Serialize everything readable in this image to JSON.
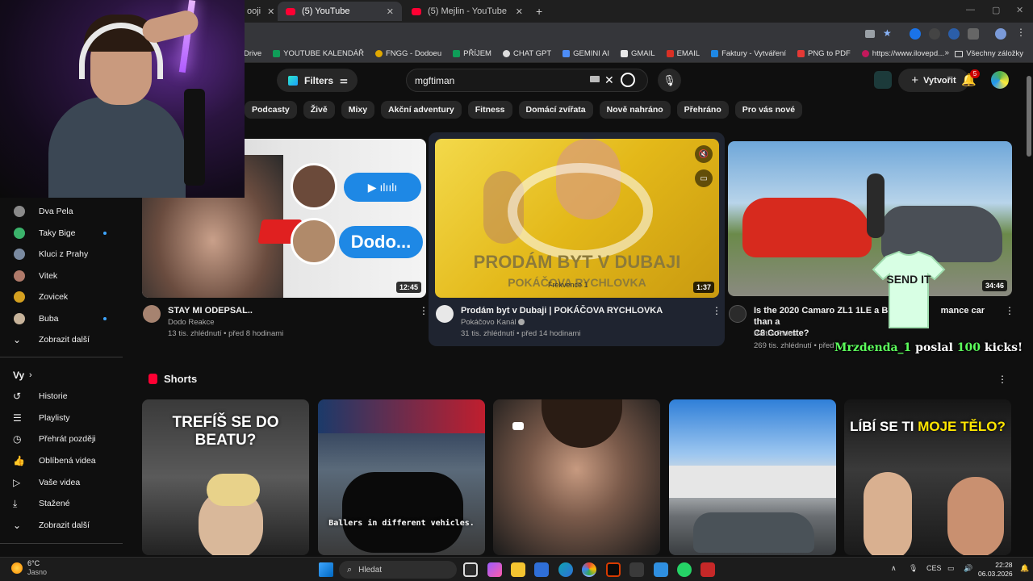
{
  "browser": {
    "tabs": [
      {
        "label": "ooji",
        "active": false
      },
      {
        "label": "(5) YouTube",
        "active": true
      },
      {
        "label": "(5) Mejlin - YouTube",
        "active": false
      }
    ],
    "bookmarks": [
      "Drive",
      "YOUTUBE KALENDÁŘ",
      "FNGG - Dodoeu",
      "PŘÍJEM",
      "CHAT GPT",
      "GEMINI AI",
      "GMAIL",
      "EMAIL",
      "Faktury - Vytváření",
      "PNG to PDF",
      "https://www.ilovepd..."
    ],
    "all_bookmarks": "Všechny záložky"
  },
  "header": {
    "filters_label": "Filters",
    "search_value": "mgftiman",
    "create_label": "Vytvořit",
    "notifications_count": "5"
  },
  "chips": [
    "Podcasty",
    "Živě",
    "Mixy",
    "Akční adventury",
    "Fitness",
    "Domácí zvířata",
    "Nově nahráno",
    "Přehráno",
    "Pro vás nové"
  ],
  "sidebar": {
    "subscriptions": [
      {
        "label": "Dva Pela",
        "color": "#8a8a8a",
        "dot": false
      },
      {
        "label": "Taky Bige",
        "color": "#3bb36b",
        "dot": true
      },
      {
        "label": "Kluci z Prahy",
        "color": "#7a8aa0",
        "dot": false
      },
      {
        "label": "Vitek",
        "color": "#b07a6a",
        "dot": false
      },
      {
        "label": "Zovicek",
        "color": "#d4a020",
        "dot": false
      },
      {
        "label": "Buba",
        "color": "#c7b39a",
        "dot": true
      }
    ],
    "show_more_1": "Zobrazit další",
    "you_heading": "Vy",
    "you_items": [
      "Historie",
      "Playlisty",
      "Přehrát později",
      "Oblíbená videa",
      "Vaše videa",
      "Stažené"
    ],
    "show_more_2": "Zobrazit další"
  },
  "videos": [
    {
      "title": "STAY MI ODEPSAL..",
      "channel": "Dodo Reakce",
      "meta": "13 tis. zhlédnutí • před 8 hodinami",
      "duration": "12:45",
      "thumb_text": "Dodo..."
    },
    {
      "title": "Prodám byt v Dubaji | POKÁČOVA RYCHLOVKA",
      "channel": "Pokáčovo Kanál",
      "meta": "31 tis. zhlédnutí • před 14 hodinami",
      "duration": "1:37",
      "thumb_text_1": "PRODÁM BYT V DUBAJI",
      "thumb_text_2": "POKÁČOVA RYCHLOVKA",
      "thumb_overlay": "Frekvence 1"
    },
    {
      "title_line1": "Is the 2020 Camaro ZL1 1LE a BE",
      "title_tail": "mance car than a",
      "title_line2": "C8 Corvette?",
      "channel": "Raiti's Rides",
      "meta": "269 tis. zhlédnutí • před",
      "duration": "34:46"
    }
  ],
  "shorts": {
    "heading": "Shorts",
    "items": [
      {
        "text": "TREFÍŠ SE DO BEATU?"
      },
      {
        "text": "Ballers in different vehicles."
      },
      {
        "text": ""
      },
      {
        "text": ""
      },
      {
        "text_a": "LÍBÍ SE TI ",
        "text_b": "MOJE TĚLO?"
      }
    ]
  },
  "overlay": {
    "donor": "Mrzdenda_1",
    "mid": " poslal ",
    "amount": "100",
    "end": " kicks!",
    "shirt_text": "SEND IT"
  },
  "taskbar": {
    "weather_temp": "6°C",
    "weather_desc": "Jasno",
    "search_placeholder": "Hledat",
    "lang": "CES",
    "time": "22:28",
    "date": "06.03.2026"
  }
}
